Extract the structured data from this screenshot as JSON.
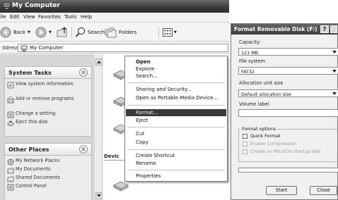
{
  "explorer": {
    "title": "My Computer",
    "menu": [
      "File",
      "Edit",
      "View",
      "Favorites",
      "Tools",
      "Help"
    ],
    "toolbar": {
      "back_label": "Back",
      "search_label": "Search",
      "folders_label": "Folders",
      "icons": {
        "back": "back-arrow-icon",
        "forward": "forward-arrow-icon",
        "up": "up-folder-icon",
        "search": "search-icon",
        "folders": "folders-icon",
        "views": "views-icon"
      }
    },
    "address": {
      "label": "ddress",
      "value": "My Computer"
    },
    "system_tasks": {
      "title": "System Tasks",
      "items": [
        {
          "label": "View system information",
          "icon": "system-info-icon"
        },
        {
          "label": "Add or remove programs",
          "icon": "add-remove-icon"
        },
        {
          "label": "Change a setting",
          "icon": "control-panel-icon"
        },
        {
          "label": "Eject this disk",
          "icon": "eject-icon"
        }
      ]
    },
    "other_places": {
      "title": "Other Places",
      "items": [
        {
          "label": "My Network Places",
          "icon": "network-icon"
        },
        {
          "label": "My Documents",
          "icon": "documents-folder-icon"
        },
        {
          "label": "Shared Documents",
          "icon": "shared-folder-icon"
        },
        {
          "label": "Control Panel",
          "icon": "control-panel-icon"
        }
      ]
    },
    "content": {
      "section_label": "Devic"
    }
  },
  "context_menu": {
    "items": [
      {
        "label": "Open",
        "bold": true
      },
      {
        "label": "Explore"
      },
      {
        "label": "Search..."
      },
      {
        "separator": true
      },
      {
        "label": "Sharing and Security..."
      },
      {
        "label": "Open as Portable Media Device..."
      },
      {
        "separator": true
      },
      {
        "label": "Format...",
        "highlighted": true
      },
      {
        "label": "Eject"
      },
      {
        "separator": true
      },
      {
        "label": "Cut"
      },
      {
        "label": "Copy"
      },
      {
        "separator": true
      },
      {
        "label": "Create Shortcut"
      },
      {
        "label": "Rename"
      },
      {
        "separator": true
      },
      {
        "label": "Properties"
      }
    ]
  },
  "format_dialog": {
    "title": "Format Removable Disk (F:)",
    "help_label": "?",
    "capacity_label": "Capacity:",
    "capacity_value": "121 MB",
    "filesystem_label": "File system",
    "filesystem_value": "FAT32",
    "allocation_label": "Allocation unit size",
    "allocation_value": "Default allocation size",
    "volume_label": "Volume label",
    "volume_value": "",
    "options_label": "Format options",
    "options": [
      {
        "label": "Quick Format",
        "enabled": true,
        "checked": false
      },
      {
        "label": "Enable Compression",
        "enabled": false,
        "checked": false
      },
      {
        "label": "Create an MS-DOS startup disk",
        "enabled": false,
        "checked": false
      }
    ],
    "progress": 0,
    "start_label": "Start",
    "close_label": "Close"
  }
}
